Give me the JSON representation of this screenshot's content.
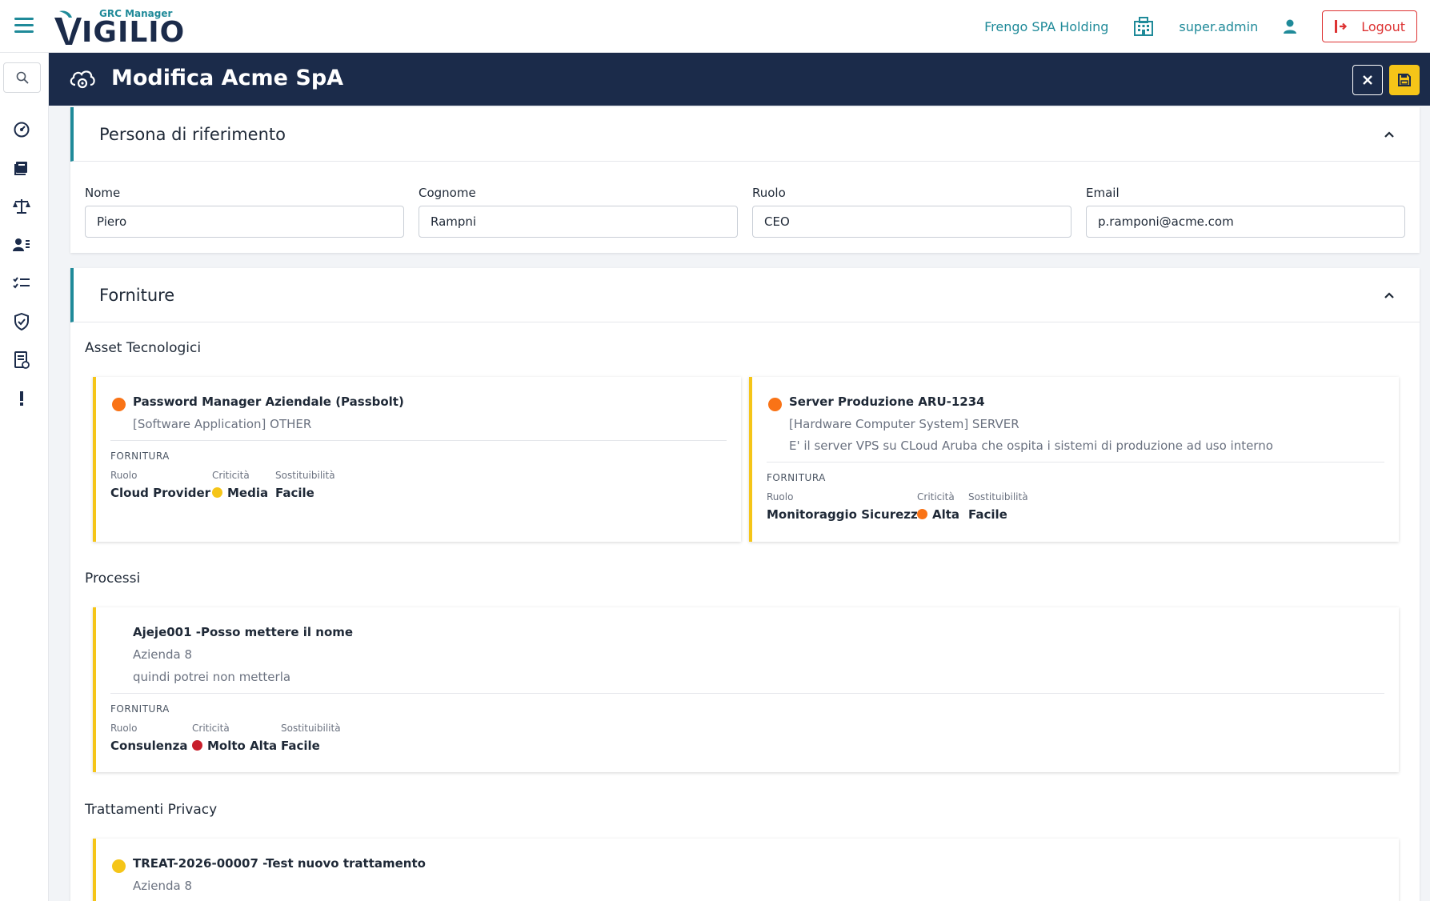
{
  "app": {
    "brand_sub": "GRC Manager",
    "brand_main": "IGILIO",
    "company": "Frengo SPA Holding",
    "user": "super.admin",
    "logout_label": "Logout"
  },
  "header": {
    "title": "Modifica Acme SpA"
  },
  "contact": {
    "title": "Persona di riferimento",
    "fields": [
      {
        "label": "Nome",
        "value": "Piero"
      },
      {
        "label": "Cognome",
        "value": "Rampni"
      },
      {
        "label": "Ruolo",
        "value": "CEO"
      },
      {
        "label": "Email",
        "value": "p.ramponi@acme.com"
      }
    ]
  },
  "supplies": {
    "title": "Forniture",
    "kicker": "FORNITURA",
    "labels": {
      "role": "Ruolo",
      "criticality": "Criticità",
      "substitutability": "Sostituibilità"
    },
    "colors": {
      "orange": "#f97316",
      "yellow": "#f5c518",
      "red": "#c81e2b"
    },
    "asset_title": "Asset Tecnologici",
    "assets": [
      {
        "name": "Password Manager Aziendale (Passbolt)",
        "type": "[Software Application] OTHER",
        "role": "Cloud Provider",
        "criticality": "Media",
        "substitutability": "Facile"
      },
      {
        "name": "Server Produzione ARU-1234",
        "type": "[Hardware Computer System] SERVER",
        "description": "E' il server VPS su CLoud Aruba che ospita i sistemi di produzione ad uso interno",
        "role": "Monitoraggio Sicurezza",
        "criticality": "Alta",
        "substitutability": "Facile"
      }
    ],
    "process_title": "Processi",
    "processes": [
      {
        "name": "Ajeje001 -Posso mettere il nome",
        "company": "Azienda 8",
        "description": "quindi potrei non metterla",
        "role": "Consulenza",
        "criticality": "Molto Alta",
        "substitutability": "Facile"
      }
    ],
    "privacy_title": "Trattamenti Privacy",
    "privacy": [
      {
        "name": "TREAT-2026-00007 -Test nuovo trattamento",
        "company": "Azienda 8"
      }
    ]
  },
  "icons": {
    "menu": "hamburger-icon",
    "building": "building-icon",
    "user": "user-icon",
    "logout": "logout-icon",
    "header": "cloud-gear-icon",
    "close": "close-icon",
    "save": "save-icon",
    "collapse": "chevron-up-icon",
    "sidebar": [
      "search-icon",
      "dashboard-gauge-icon",
      "books-icon",
      "balance-scale-icon",
      "user-list-icon",
      "checklist-icon",
      "shield-check-icon",
      "report-icon",
      "exclamation-icon"
    ]
  }
}
